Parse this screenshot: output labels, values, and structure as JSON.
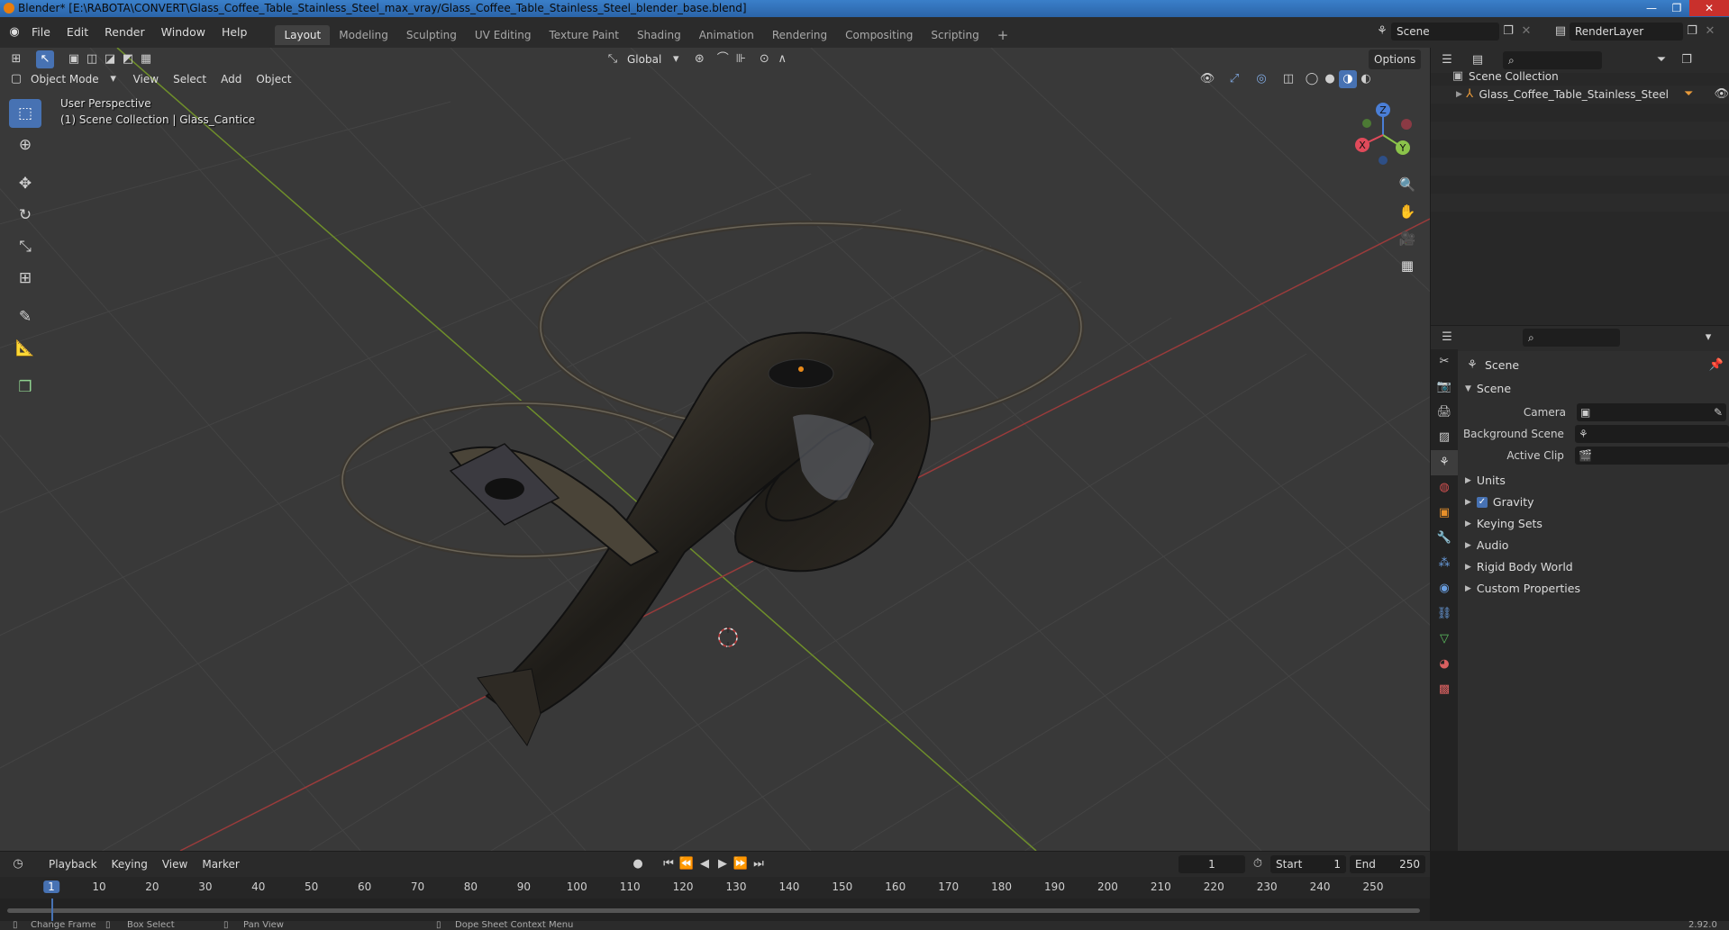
{
  "window": {
    "title": "Blender* [E:\\RABOTA\\CONVERT\\Glass_Coffee_Table_Stainless_Steel_max_vray/Glass_Coffee_Table_Stainless_Steel_blender_base.blend]",
    "minimize": "—",
    "maximize": "❐",
    "close": "✕"
  },
  "menubar": {
    "menus": [
      "File",
      "Edit",
      "Render",
      "Window",
      "Help"
    ],
    "workspaces": [
      "Layout",
      "Modeling",
      "Sculpting",
      "UV Editing",
      "Texture Paint",
      "Shading",
      "Animation",
      "Rendering",
      "Compositing",
      "Scripting"
    ],
    "add_workspace": "+",
    "scene_name": "Scene",
    "view_layer": "RenderLayer"
  },
  "viewport": {
    "transform_orientation": "Global",
    "options_label": "Options",
    "mode": "Object Mode",
    "menus": [
      "View",
      "Select",
      "Add",
      "Object"
    ],
    "overlay_line1": "User Perspective",
    "overlay_line2": "(1) Scene Collection | Glass_Cantice",
    "gizmo": {
      "x": "X",
      "y": "Y",
      "z": "Z"
    }
  },
  "outliner": {
    "root": "Scene Collection",
    "items": [
      {
        "name": "Glass_Coffee_Table_Stainless_Steel"
      }
    ]
  },
  "properties": {
    "context_title": "Scene",
    "section_scene": "Scene",
    "fields": [
      {
        "label": "Camera",
        "value": ""
      },
      {
        "label": "Background Scene",
        "value": ""
      },
      {
        "label": "Active Clip",
        "value": ""
      }
    ],
    "panels": [
      "Units",
      "Gravity",
      "Keying Sets",
      "Audio",
      "Rigid Body World",
      "Custom Properties"
    ],
    "gravity_checked": true
  },
  "timeline": {
    "menus": [
      "Playback",
      "Keying",
      "View",
      "Marker"
    ],
    "current_frame": "1",
    "start_label": "Start",
    "start_value": "1",
    "end_label": "End",
    "end_value": "250",
    "ruler": [
      "1",
      "10",
      "20",
      "30",
      "40",
      "50",
      "60",
      "70",
      "80",
      "90",
      "100",
      "110",
      "120",
      "130",
      "140",
      "150",
      "160",
      "170",
      "180",
      "190",
      "200",
      "210",
      "220",
      "230",
      "240",
      "250"
    ]
  },
  "statusbar": {
    "items": [
      "Change Frame",
      "Box Select",
      "Pan View",
      "Dope Sheet Context Menu"
    ],
    "version": "2.92.0"
  }
}
